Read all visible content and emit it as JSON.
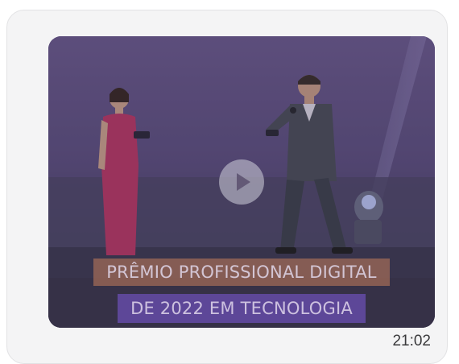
{
  "message": {
    "timestamp": "21:02",
    "video": {
      "caption_line_1": "PRÊMIO PROFISSIONAL DIGITAL",
      "caption_line_2": "DE 2022 EM TECNOLOGIA",
      "play_icon": "play-icon",
      "thumbnail_scene": "two presenters on stage"
    }
  }
}
